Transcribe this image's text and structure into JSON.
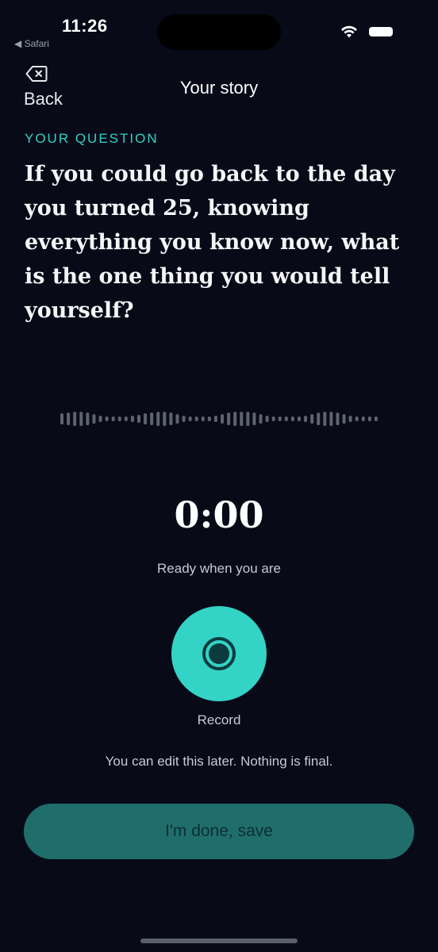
{
  "status_bar": {
    "time": "11:26",
    "back_app": "◀ Safari"
  },
  "header": {
    "back_label": "Back",
    "title": "Your story"
  },
  "question": {
    "eyebrow": "YOUR QUESTION",
    "text": "If you could go back to the day you turned 25, knowing everything you know now, what is the one thing you would tell yourself?"
  },
  "recorder": {
    "timer": "0:00",
    "status": "Ready when you are",
    "record_label": "Record",
    "hint": "You can edit this later. Nothing is final."
  },
  "footer": {
    "save_label": "I'm done, save"
  },
  "colors": {
    "background": "#080a18",
    "accent": "#2ed3c4",
    "record_button": "#33d3c6",
    "save_button": "#1f6e6c",
    "waveform": "#5f6370"
  },
  "icons": {
    "back": "backspace-x-icon",
    "record": "record-dot-icon",
    "wifi": "wifi-icon",
    "battery": "battery-icon"
  }
}
